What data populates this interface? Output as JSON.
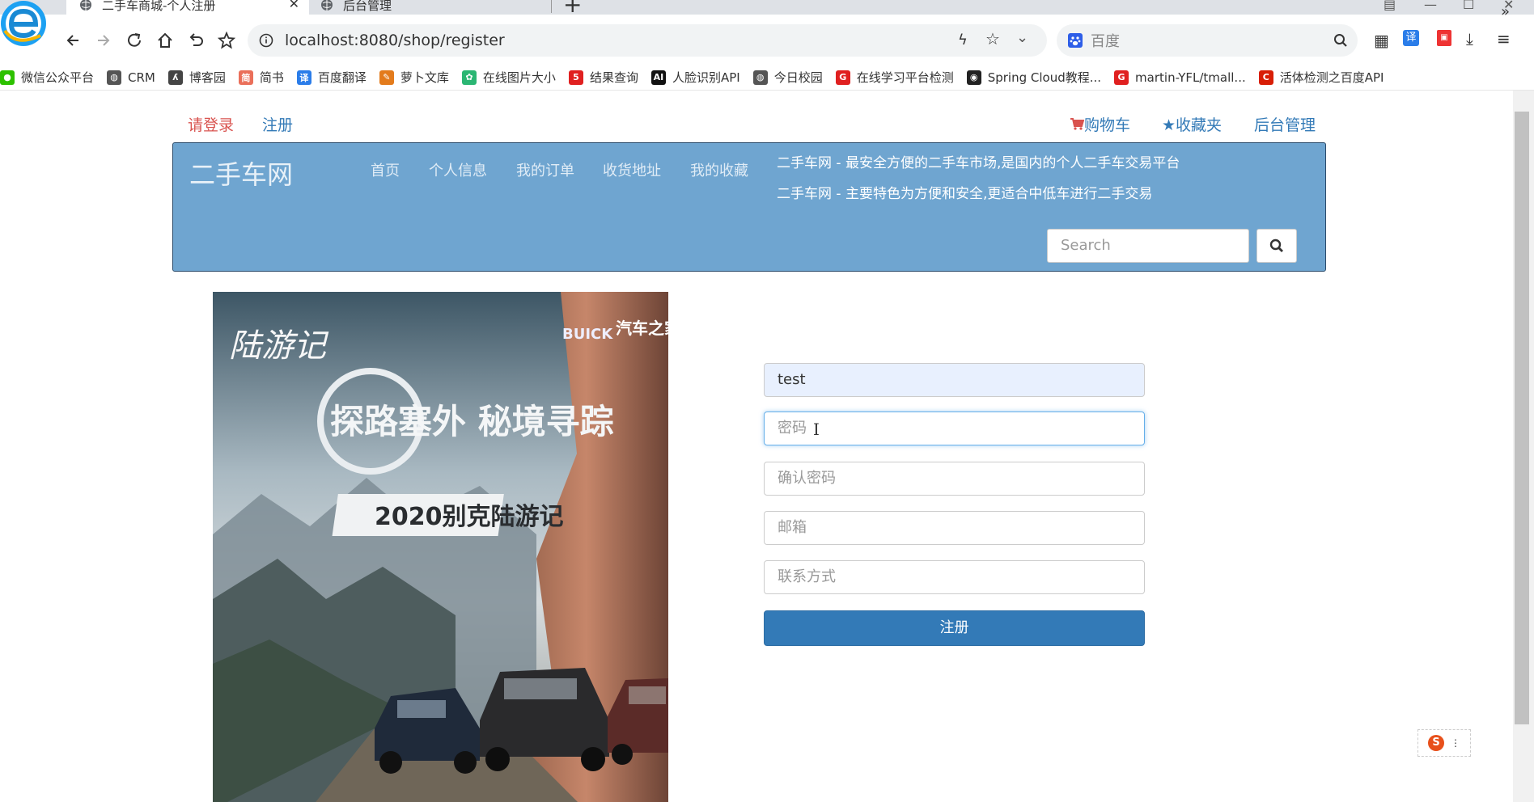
{
  "browser": {
    "tabs": [
      {
        "label": "二手车商城-个人注册",
        "active": true
      },
      {
        "label": "后台管理",
        "active": false
      }
    ],
    "url": "localhost:8080/shop/register",
    "search_engine_placeholder": "百度",
    "bookmarks": [
      {
        "label": "微信公众平台",
        "icon": "wechat-icon",
        "color": "#2dc100"
      },
      {
        "label": "CRM",
        "icon": "globe-icon",
        "color": "#555555"
      },
      {
        "label": "博客园",
        "icon": "cnblogs-icon",
        "color": "#444444"
      },
      {
        "label": "简书",
        "icon": "jianshu-icon",
        "color": "#ea6f5a"
      },
      {
        "label": "百度翻译",
        "icon": "translate-icon",
        "color": "#2b7de9"
      },
      {
        "label": "萝卜文库",
        "icon": "carrot-icon",
        "color": "#e37b1c"
      },
      {
        "label": "在线图片大小",
        "icon": "gear-flower-icon",
        "color": "#2bb673"
      },
      {
        "label": "结果查询",
        "icon": "five-icon",
        "color": "#e02020"
      },
      {
        "label": "人脸识别API",
        "icon": "ai-icon",
        "color": "#111111"
      },
      {
        "label": "今日校园",
        "icon": "globe-icon",
        "color": "#555555"
      },
      {
        "label": "在线学习平台检测",
        "icon": "g-red-icon",
        "color": "#e02020"
      },
      {
        "label": "Spring Cloud教程...",
        "icon": "github-icon",
        "color": "#222222"
      },
      {
        "label": "martin-YFL/tmall...",
        "icon": "g-red-icon",
        "color": "#e02020"
      },
      {
        "label": "活体检测之百度API",
        "icon": "c-red-icon",
        "color": "#d81e06"
      }
    ],
    "more_bookmarks": "»"
  },
  "topnav": {
    "login": "请登录",
    "register": "注册",
    "cart": "购物车",
    "favorites": "收藏夹",
    "admin": "后台管理"
  },
  "hero": {
    "brand": "二手车网",
    "nav": [
      "首页",
      "个人信息",
      "我的订单",
      "收货地址",
      "我的收藏"
    ],
    "slogans": [
      "二手车网 - 最安全方便的二手车市场,是国内的个人二手车交易平台",
      "二手车网 - 主要特色为方便和安全,更适合中低车进行二手交易"
    ],
    "search_placeholder": "Search"
  },
  "banner": {
    "line1": "探路塞外 秘境寻踪",
    "line2": "2020别克陆游记",
    "brand": "BUICK",
    "partner": "汽车之家",
    "script": "陆游记"
  },
  "form": {
    "username_value": "test",
    "password_placeholder": "密码",
    "confirm_placeholder": "确认密码",
    "email_placeholder": "邮箱",
    "contact_placeholder": "联系方式",
    "submit": "注册"
  },
  "colors": {
    "hero_bg": "#6fa5d0",
    "primary": "#337ab7",
    "login_red": "#d9534f"
  }
}
